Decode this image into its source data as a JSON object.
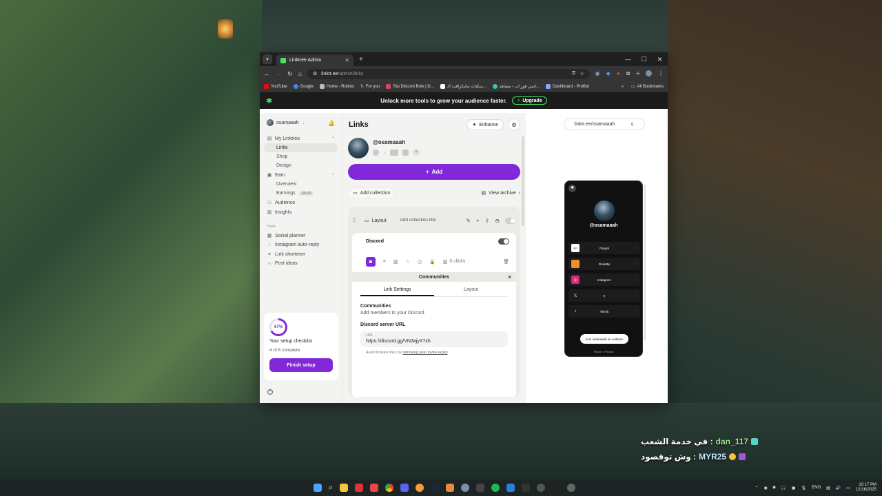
{
  "browser": {
    "tab_title": "Linktree Admin",
    "url_host": "linktr.ee",
    "url_path": "/admin/links",
    "window_controls": [
      "—",
      "☐",
      "✕"
    ],
    "bookmarks": [
      {
        "label": "YouTube",
        "color": "#ff0000"
      },
      {
        "label": "Google",
        "color": "#4285f4"
      },
      {
        "label": "Home - Roblox",
        "color": "#bbbbbb"
      },
      {
        "label": "For you",
        "color": "#ffffff"
      },
      {
        "label": "Top Discord Bots | D...",
        "color": "#e4405f"
      },
      {
        "label": "سكنات مانيكرافت الـ...",
        "color": "#ffffff"
      },
      {
        "label": "انمي فور اب - مشاهد...",
        "color": "#39c5bb"
      },
      {
        "label": "Dashboard - ProBot",
        "color": "#8aa4ff"
      }
    ],
    "all_bookmarks": "All Bookmarks"
  },
  "banner": {
    "text": "Unlock more tools to grow your audience faster.",
    "upgrade": "Upgrade"
  },
  "sidebar": {
    "account": "osamaaah",
    "my_linktree": "My Linktree",
    "links": "Links",
    "shop": "Shop",
    "design": "Design",
    "earn": "Earn",
    "overview": "Overview",
    "earnings": "Earnings",
    "earnings_value": "$0.00",
    "audience": "Audience",
    "insights": "Insights",
    "tools_label": "Tools",
    "social_planner": "Social planner",
    "instagram_autoreply": "Instagram auto-reply",
    "link_shortener": "Link shortener",
    "post_ideas": "Post ideas",
    "setup": {
      "percent": "67%",
      "percent_value": 0.67,
      "title": "Your setup checklist",
      "progress": "4 of 6 complete",
      "button": "Finish setup"
    }
  },
  "main": {
    "title": "Links",
    "enhance": "Enhance",
    "handle": "@osamaaah",
    "add": "Add",
    "add_collection": "Add collection",
    "view_archive": "View archive",
    "collection": {
      "layout": "Layout",
      "title_placeholder": "Add collection title"
    },
    "link": {
      "title": "Discord",
      "clicks": "0 clicks",
      "panel_title": "Communities",
      "tab_settings": "Link Settings",
      "tab_layout": "Layout",
      "section_title": "Communities",
      "section_sub": "Add members to your Discord",
      "url_section": "Discord server URL",
      "url_label": "URL",
      "url_value": "https://discord.gg/VN3ajyX7xh",
      "hint_prefix": "Avoid broken links by ",
      "hint_link": "removing your invite expiry",
      "hint_suffix": "."
    }
  },
  "preview": {
    "url": "linktr.ee/osamaaah",
    "handle": "@osamaaah",
    "links": [
      {
        "label": "Paypal",
        "icon_bg": "#ffffff",
        "icon": "PP"
      },
      {
        "label": "DokeBp",
        "icon_bg": "#f28b2c",
        "icon": "🎒"
      },
      {
        "label": "Instagram",
        "icon_bg": "#d62976",
        "icon": "◎"
      },
      {
        "label": "X",
        "icon_bg": "#1c1c1c",
        "icon": "𝕏"
      },
      {
        "label": "TikTok",
        "icon_bg": "#1c1c1c",
        "icon": "♪"
      }
    ],
    "join": "Join osamaaah on Linktree",
    "footer": "Report  •  Privacy"
  },
  "chat": [
    {
      "user": "dan_117",
      "message": "في خدمة الشعب :"
    },
    {
      "user": "MYR25",
      "message": "وش توقصود :"
    }
  ],
  "taskbar": {
    "lang": "ENG",
    "time": "10:17 PM",
    "date": "12/16/2025"
  }
}
